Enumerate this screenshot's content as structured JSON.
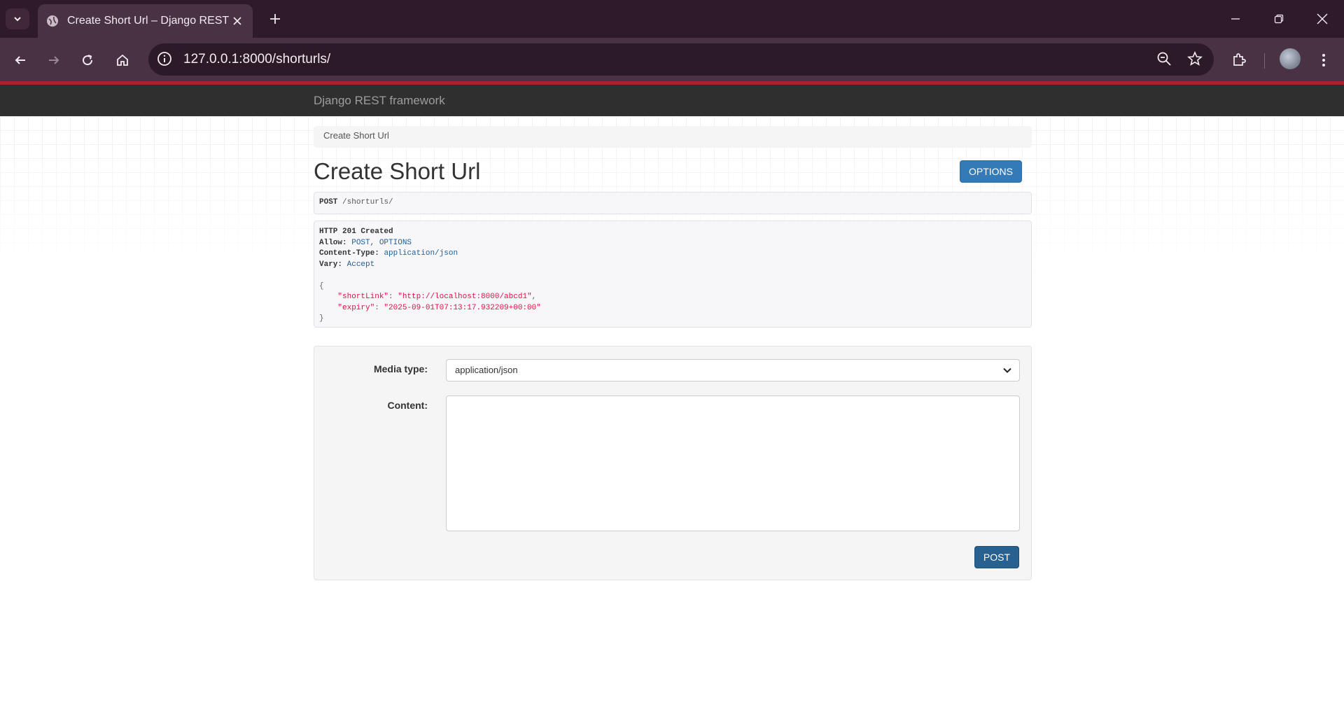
{
  "browser": {
    "tab_title": "Create Short Url – Django REST fra",
    "url": "127.0.0.1:8000/shorturls/"
  },
  "navbar": {
    "brand": "Django REST framework"
  },
  "breadcrumb": {
    "current": "Create Short Url"
  },
  "page": {
    "title": "Create Short Url",
    "options_label": "OPTIONS"
  },
  "request": {
    "method": "POST",
    "path": "/shorturls/"
  },
  "response": {
    "status": "HTTP 201 Created",
    "headers": [
      {
        "key": "Allow:",
        "value": "POST, OPTIONS"
      },
      {
        "key": "Content-Type:",
        "value": "application/json"
      },
      {
        "key": "Vary:",
        "value": "Accept"
      }
    ],
    "body": {
      "open": "{",
      "close": "}",
      "fields": [
        {
          "key": "\"shortLink\"",
          "value": "\"http://localhost:8000/abcd1\"",
          "trail": ","
        },
        {
          "key": "\"expiry\"",
          "value": "\"2025-09-01T07:13:17.932209+00:00\"",
          "trail": ""
        }
      ]
    }
  },
  "form": {
    "media_type_label": "Media type:",
    "media_type_value": "application/json",
    "content_label": "Content:",
    "content_value": "",
    "post_label": "POST"
  },
  "icons": {
    "tab_search": "chevron-down-icon",
    "favicon": "globe-icon",
    "tab_close": "close-icon",
    "new_tab": "plus-icon",
    "minimize": "minimize-icon",
    "restore": "restore-icon",
    "window_close": "close-icon",
    "back": "arrow-left-icon",
    "forward": "arrow-right-icon",
    "reload": "reload-icon",
    "home": "home-icon",
    "site_info": "info-icon",
    "zoom": "zoom-out-icon",
    "bookmark": "star-icon",
    "extensions": "puzzle-icon",
    "menu": "kebab-menu-icon"
  }
}
